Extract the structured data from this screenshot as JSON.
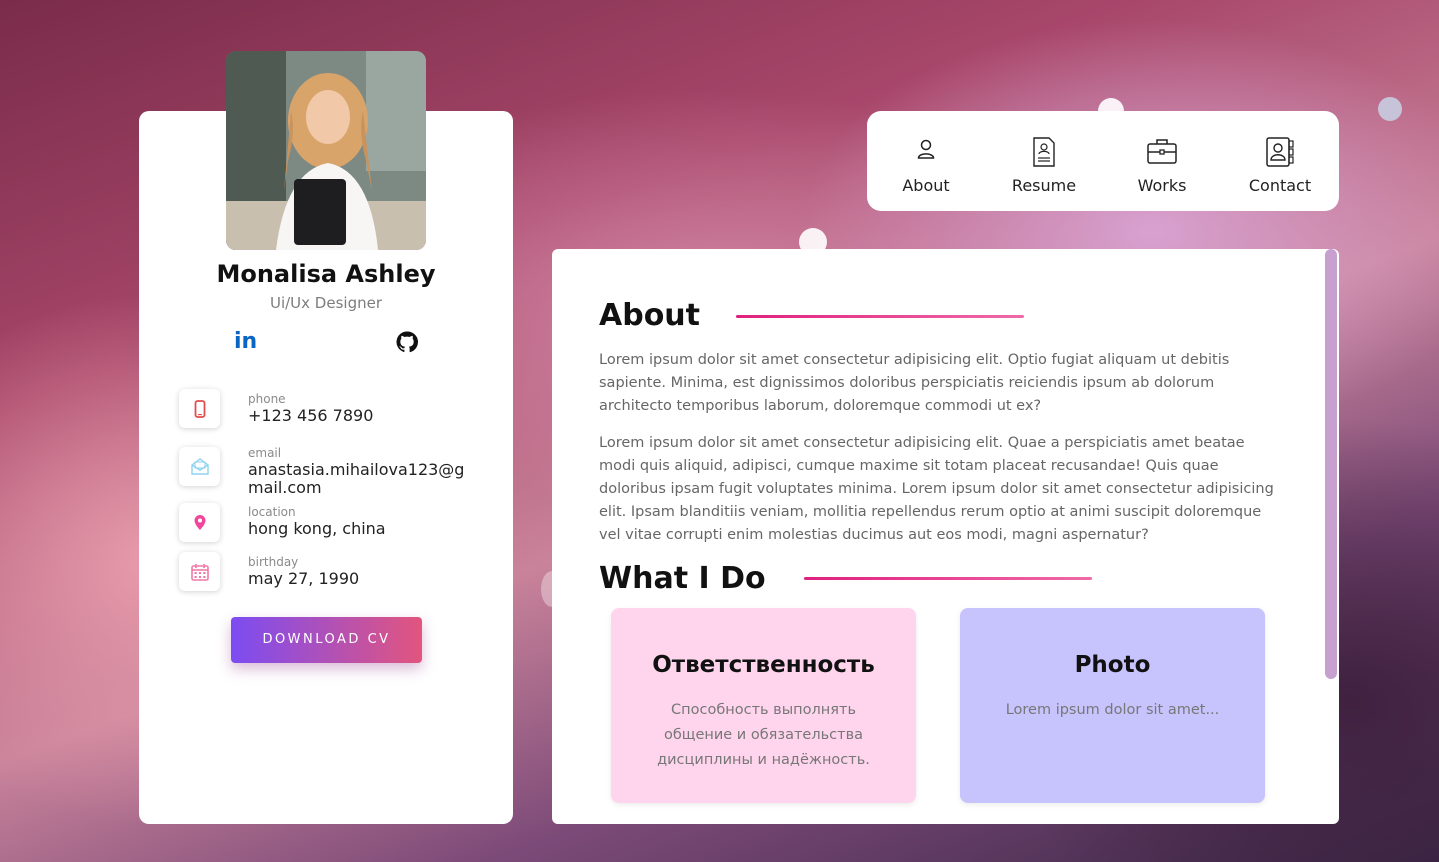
{
  "profile": {
    "name": "Monalisa Ashley",
    "role": "Ui/Ux Designer",
    "social": [
      {
        "icon": "linkedin-icon",
        "label": "in"
      },
      {
        "icon": "github-icon"
      }
    ],
    "contacts": [
      {
        "icon": "phone-icon",
        "label": "phone",
        "value": "+123 456 7890"
      },
      {
        "icon": "email-icon",
        "label": "email",
        "value": "anastasia.mihailova123@gmail.com"
      },
      {
        "icon": "location-icon",
        "label": "location",
        "value": "hong kong, china"
      },
      {
        "icon": "calendar-icon",
        "label": "birthday",
        "value": "may 27, 1990"
      }
    ],
    "download_label": "DOWNLOAD CV"
  },
  "nav": {
    "items": [
      {
        "icon": "user-icon",
        "label": "About"
      },
      {
        "icon": "resume-icon",
        "label": "Resume"
      },
      {
        "icon": "briefcase-icon",
        "label": "Works"
      },
      {
        "icon": "contact-book-icon",
        "label": "Contact"
      }
    ]
  },
  "about": {
    "title": "About",
    "paragraphs": [
      "Lorem ipsum dolor sit amet consectetur adipisicing elit. Optio fugiat aliquam ut debitis sapiente. Minima, est dignissimos doloribus perspiciatis reiciendis ipsum ab dolorum architecto temporibus laborum, doloremque commodi ut ex?",
      "Lorem ipsum dolor sit amet consectetur adipisicing elit. Quae a perspiciatis amet beatae modi quis aliquid, adipisci, cumque maxime sit totam placeat recusandae! Quis quae doloribus ipsam fugit voluptates minima. Lorem ipsum dolor sit amet consectetur adipisicing elit. Ipsam blanditiis veniam, mollitia repellendus rerum optio at animi suscipit doloremque vel vitae corrupti enim molestias ducimus aut eos modi, magni aspernatur?"
    ]
  },
  "what_i_do": {
    "title": "What I Do",
    "services": [
      {
        "title": "Ответственность",
        "description": "Способность выполнять общение и обязательства дисциплины и надёжность."
      },
      {
        "title": "Photo",
        "description": "Lorem ipsum dolor sit amet..."
      }
    ]
  },
  "colors": {
    "accent_gradient_start": "#7c4cf2",
    "accent_gradient_end": "#e2557e",
    "title_underline": "#e0207f",
    "service_pink": "#ffd5ee",
    "service_purple": "#c7c3fd"
  }
}
